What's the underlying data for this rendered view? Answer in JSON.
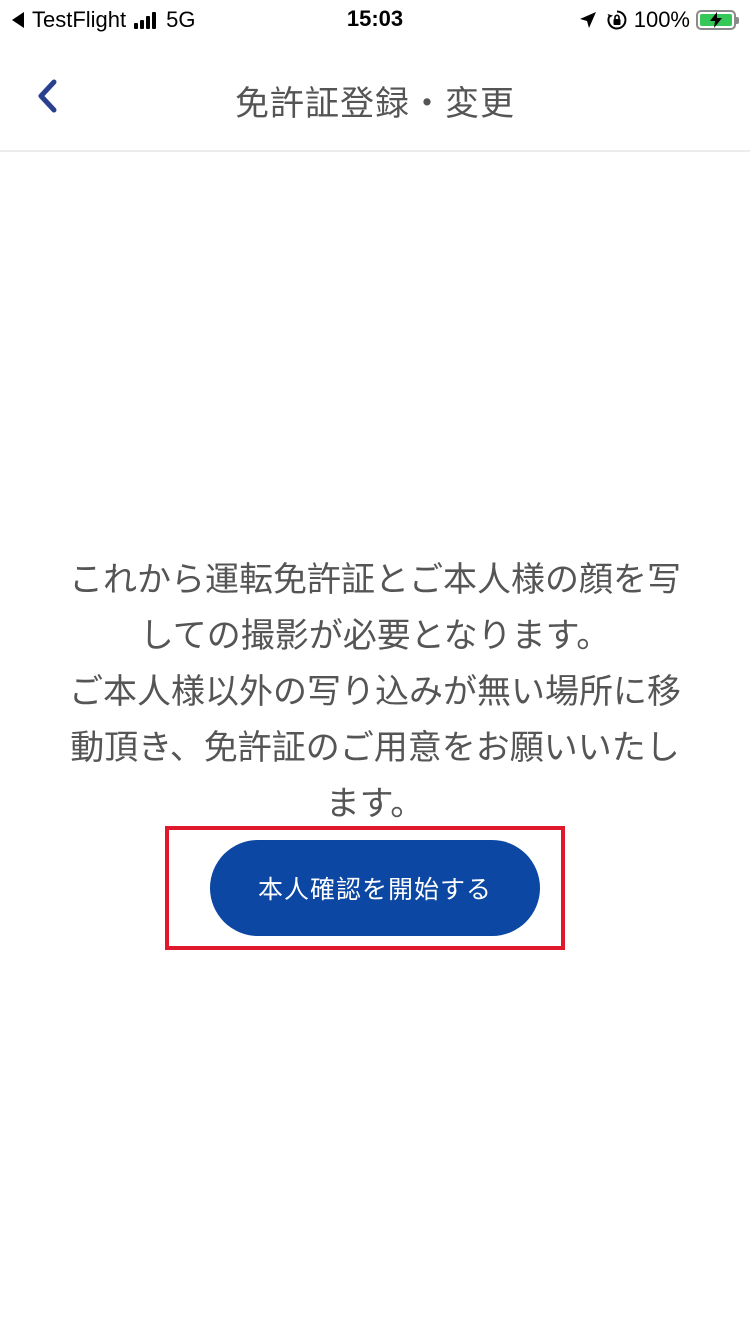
{
  "colors": {
    "brand_blue": "#0b47a3",
    "back_chevron": "#2b3f91",
    "title_text": "#555555",
    "body_text": "#555555",
    "highlight_red": "#e0182d",
    "battery_green": "#36c759"
  },
  "status_bar": {
    "back_app": "TestFlight",
    "network": "5G",
    "time": "15:03",
    "battery_percent": "100%",
    "battery_level": 1.0,
    "icons": [
      "back-triangle-icon",
      "signal-icon",
      "location-arrow-icon",
      "rotation-lock-icon",
      "battery-charging-icon"
    ]
  },
  "nav": {
    "back_icon": "chevron-left-icon",
    "title": "免許証登録・変更"
  },
  "content": {
    "instruction_lines": [
      "これから運転免許証とご本人様の顔を写",
      "しての撮影が必要となります。",
      "ご本人様以外の写り込みが無い場所に移",
      "動頂き、免許証のご用意をお願いいたし",
      "ます。"
    ],
    "start_button_label": "本人確認を開始する"
  }
}
